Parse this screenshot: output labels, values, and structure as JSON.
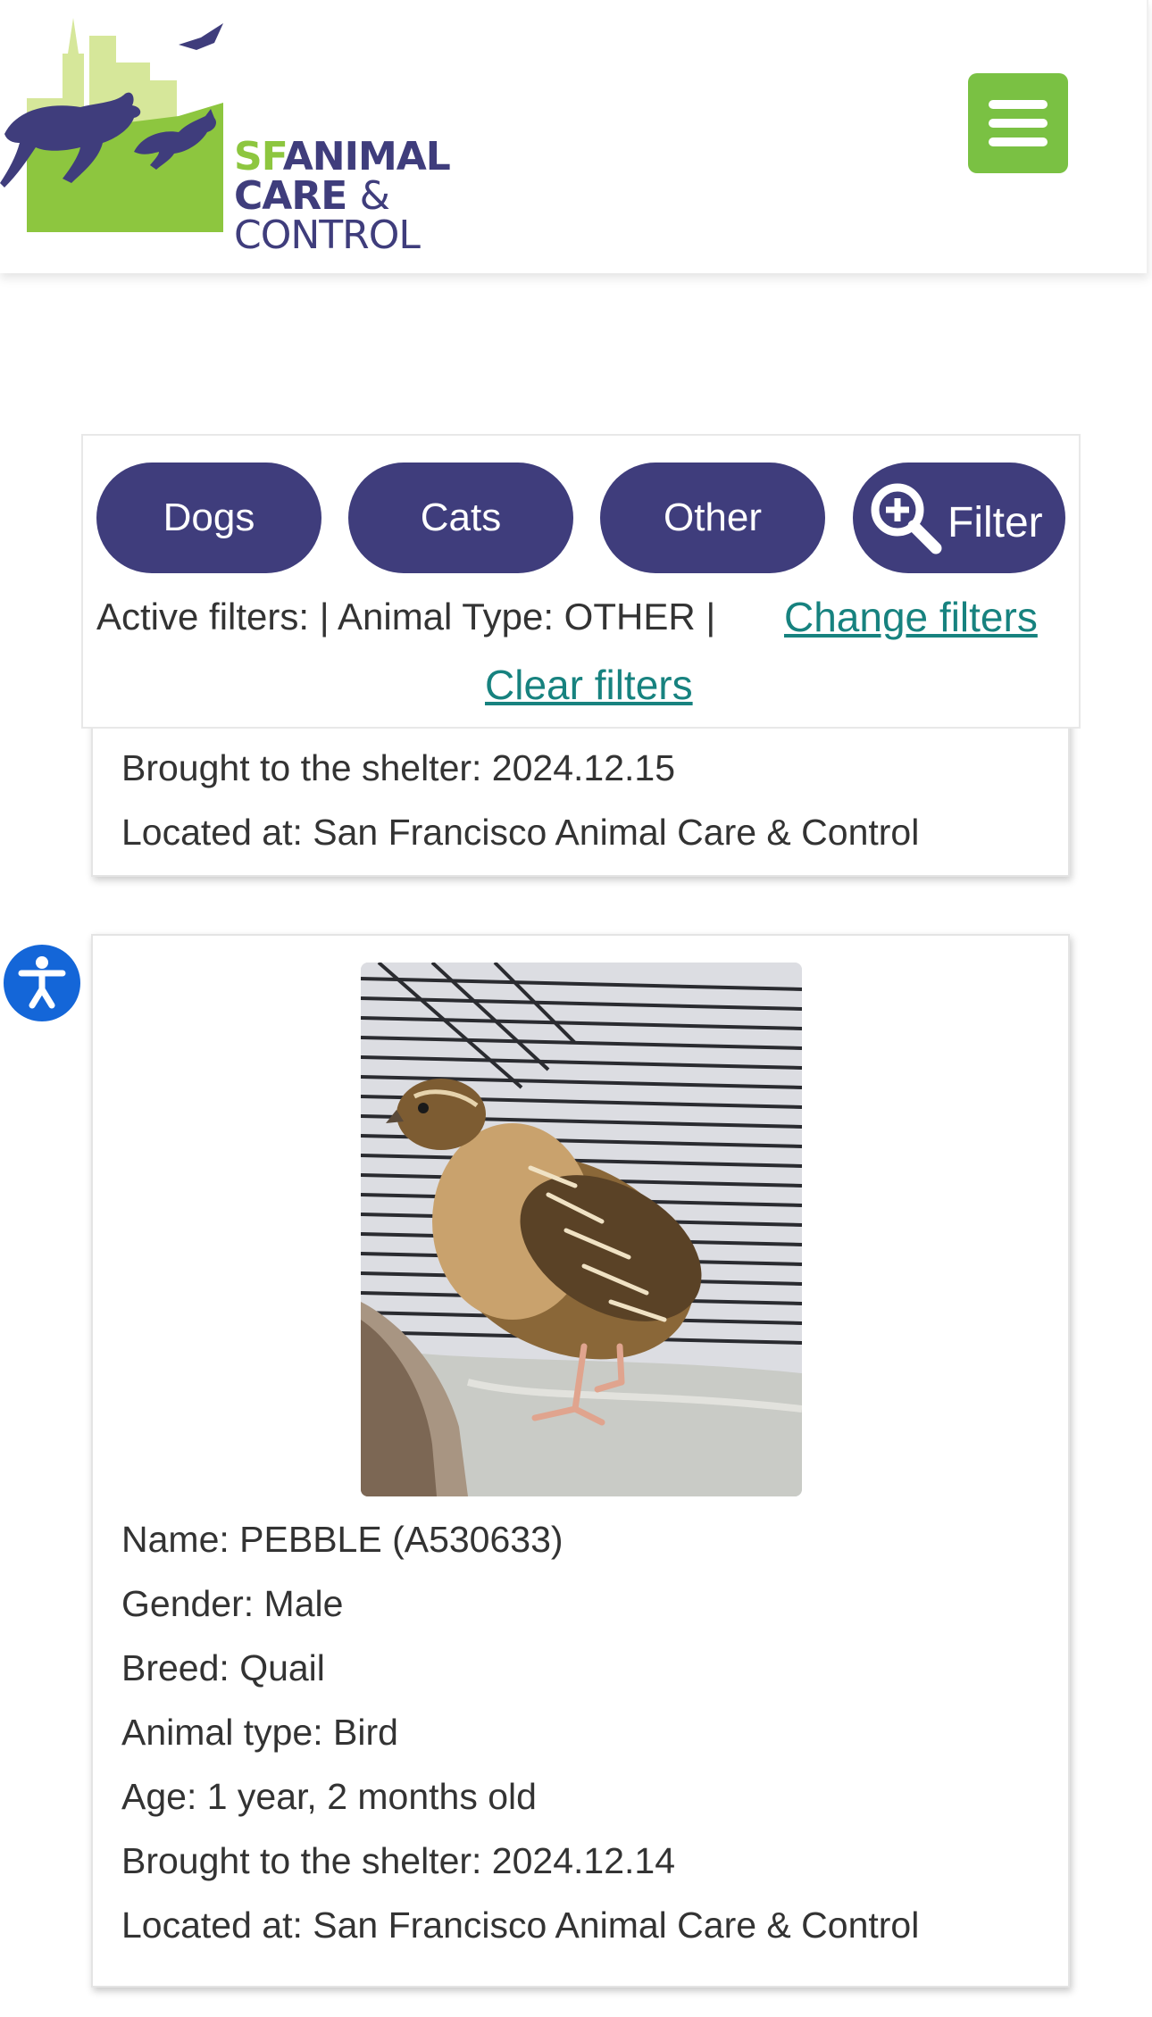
{
  "header": {
    "logo": {
      "sf": "SF",
      "animal": "ANIMAL",
      "care": "CARE",
      "amp": "&",
      "control": "CONTROL"
    },
    "menu_icon": "hamburger-menu-icon"
  },
  "filters": {
    "pills": {
      "dogs": "Dogs",
      "cats": "Cats",
      "other": "Other",
      "filter": "Filter"
    },
    "active_text": "Active filters: | Animal Type: OTHER |",
    "change_link": "Change filters",
    "clear_link": "Clear filters"
  },
  "previous_card": {
    "brought": "Brought to the shelter: 2024.12.15",
    "located": "Located at: San Francisco Animal Care & Control"
  },
  "animal_card": {
    "name": "Name: PEBBLE (A530633)",
    "gender": "Gender: Male",
    "breed": "Breed: Quail",
    "type": "Animal type: Bird",
    "age": "Age: 1 year, 2 months old",
    "brought": "Brought to the shelter: 2024.12.14",
    "located": "Located at: San Francisco Animal Care & Control"
  },
  "colors": {
    "brand_purple": "#3f3d7c",
    "brand_green": "#8dc63f",
    "menu_green": "#7ac143",
    "link_teal": "#17827f",
    "a11y_blue": "#1466d8"
  }
}
